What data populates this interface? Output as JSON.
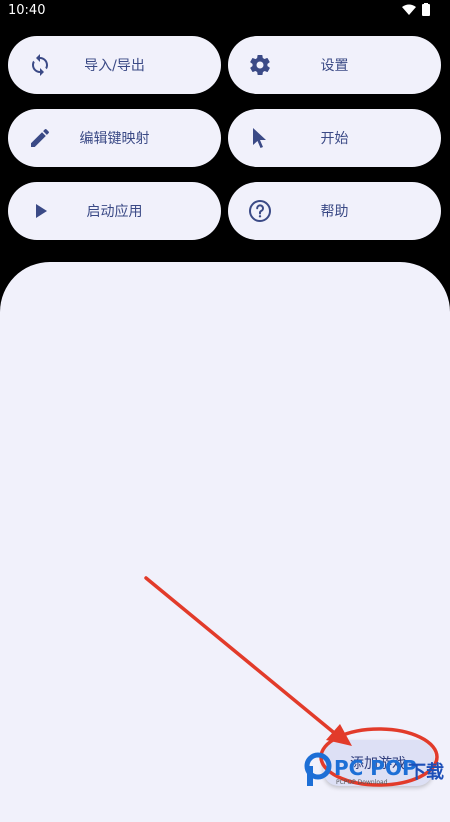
{
  "status": {
    "time": "10:40"
  },
  "buttons": {
    "import_export": "导入/导出",
    "settings": "设置",
    "edit_keymap": "编辑键映射",
    "start": "开始",
    "launch_app": "启动应用",
    "help": "帮助"
  },
  "fab": {
    "label": "添加游戏"
  },
  "watermark": {
    "brand": "PC POP",
    "cn": "下载",
    "sub": "PCPOP Download"
  },
  "colors": {
    "accent": "#3b4a86",
    "surface": "#f1f1fb",
    "annotation": "#e23b2a"
  }
}
